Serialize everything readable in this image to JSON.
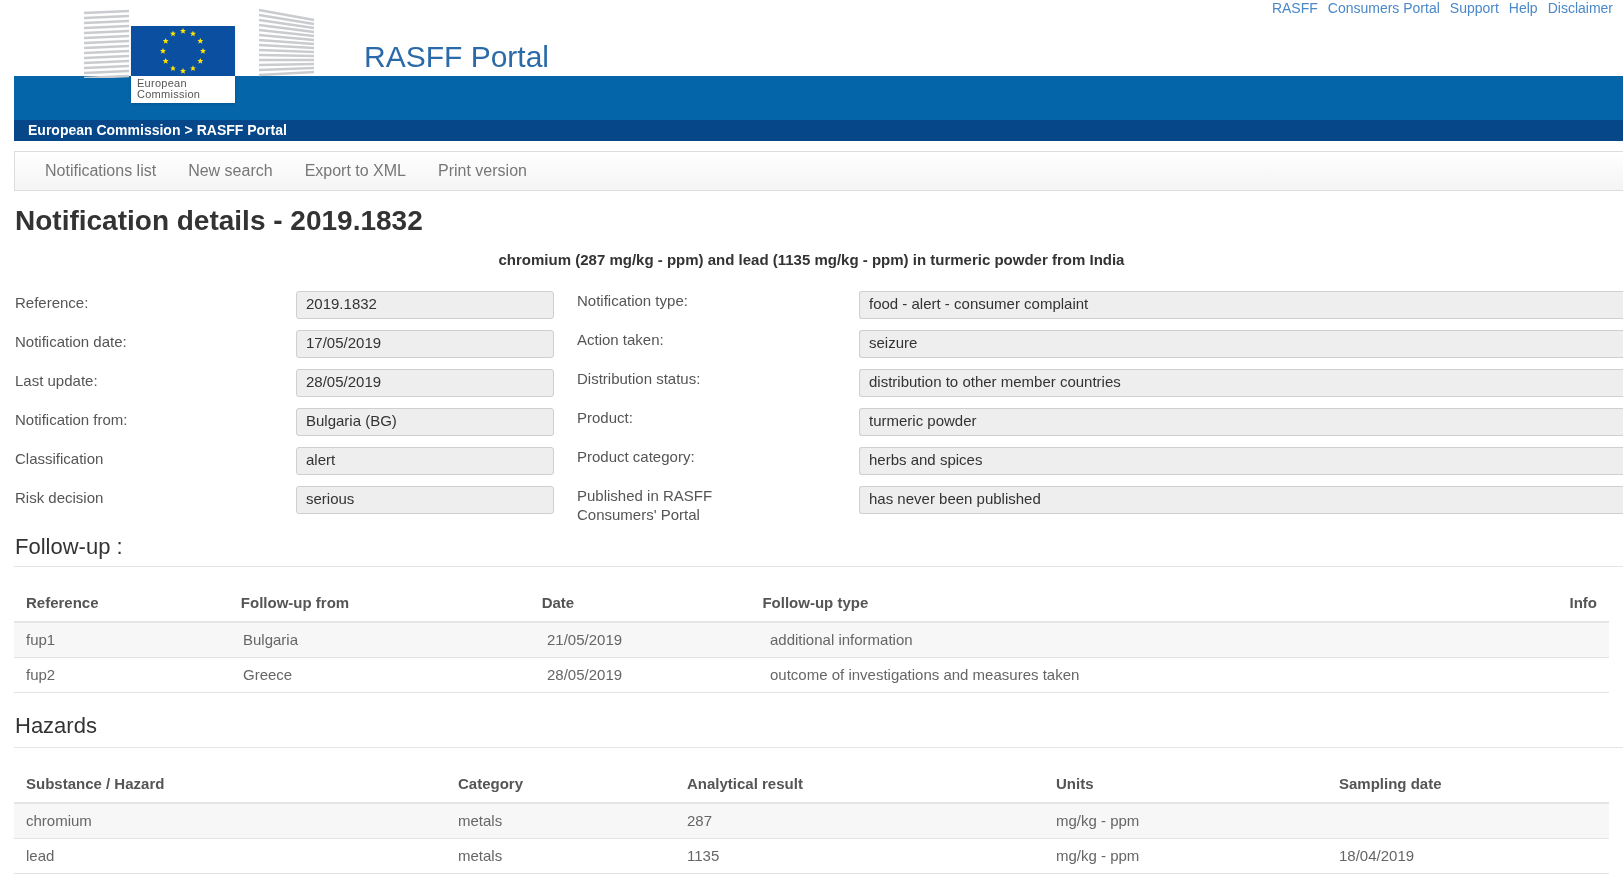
{
  "top_links": [
    "RASFF",
    "Consumers Portal",
    "Support",
    "Help",
    "Disclaimer"
  ],
  "logo": {
    "text_1": "European",
    "text_2": "Commission"
  },
  "site_title": "RASFF Portal",
  "breadcrumb": [
    "European Commission",
    "RASFF Portal"
  ],
  "breadcrumb_separator": ">",
  "nav": [
    "Notifications list",
    "New search",
    "Export to XML",
    "Print version"
  ],
  "page_title": "Notification details - 2019.1832",
  "subject": "chromium (287 mg/kg - ppm) and lead (1135 mg/kg - ppm) in turmeric powder from India",
  "fields_left": [
    {
      "label": "Reference:",
      "value": "2019.1832"
    },
    {
      "label": "Notification date:",
      "value": "17/05/2019"
    },
    {
      "label": "Last update:",
      "value": "28/05/2019"
    },
    {
      "label": "Notification from:",
      "value": "Bulgaria (BG)"
    },
    {
      "label": "Classification",
      "value": "alert"
    },
    {
      "label": "Risk decision",
      "value": "serious"
    }
  ],
  "fields_right": [
    {
      "label": "Notification type:",
      "value": "food - alert - consumer complaint"
    },
    {
      "label": "Action taken:",
      "value": "seizure"
    },
    {
      "label": "Distribution status:",
      "value": "distribution to other member countries"
    },
    {
      "label": "Product:",
      "value": "turmeric powder"
    },
    {
      "label": "Product category:",
      "value": "herbs and spices"
    },
    {
      "label": "Published in RASFF Consumers' Portal",
      "value": "has never been published"
    }
  ],
  "followup": {
    "heading": "Follow-up :",
    "columns": [
      "Reference",
      "Follow-up from",
      "Date",
      "Follow-up type",
      "Info"
    ],
    "rows": [
      [
        "fup1",
        "Bulgaria",
        "21/05/2019",
        "additional information",
        ""
      ],
      [
        "fup2",
        "Greece",
        "28/05/2019",
        "outcome of investigations and measures taken",
        ""
      ]
    ]
  },
  "hazards": {
    "heading": "Hazards",
    "columns": [
      "Substance / Hazard",
      "Category",
      "Analytical result",
      "Units",
      "Sampling date"
    ],
    "rows": [
      [
        "chromium",
        "metals",
        "287",
        "mg/kg - ppm",
        ""
      ],
      [
        "lead",
        "metals",
        "1135",
        "mg/kg - ppm",
        "18/04/2019"
      ]
    ]
  }
}
